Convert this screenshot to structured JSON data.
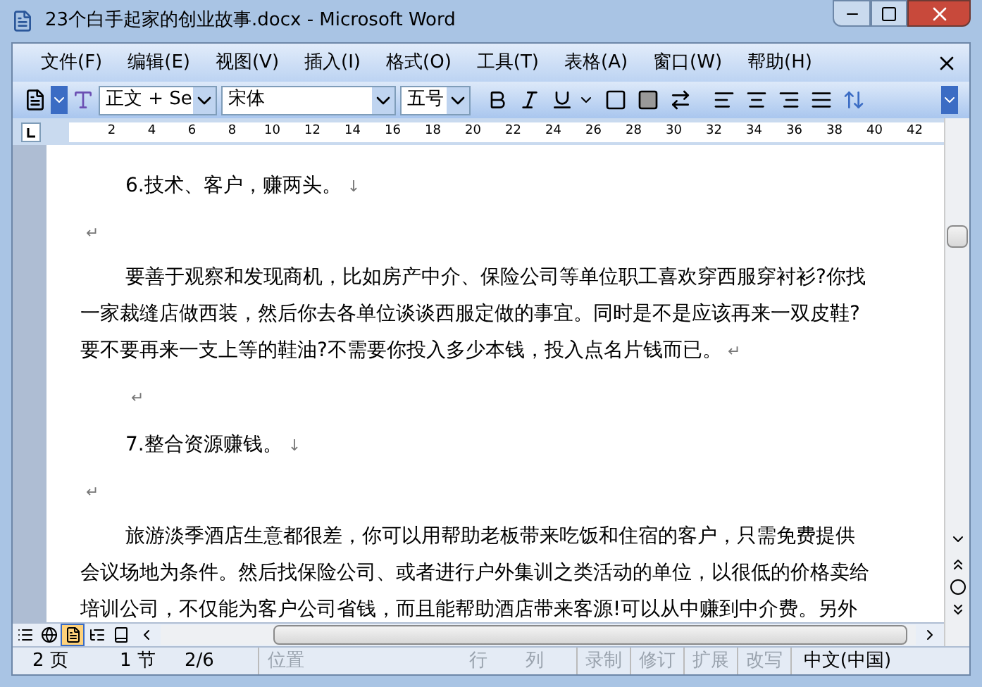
{
  "window": {
    "title": "23个白手起家的创业故事.docx - Microsoft Word"
  },
  "menu": [
    "文件(F)",
    "编辑(E)",
    "视图(V)",
    "插入(I)",
    "格式(O)",
    "工具(T)",
    "表格(A)",
    "窗口(W)",
    "帮助(H)"
  ],
  "toolbar": {
    "style": "正文 + Se",
    "font": "宋体",
    "size": "五号"
  },
  "ruler": [
    "2",
    "4",
    "6",
    "8",
    "10",
    "12",
    "14",
    "16",
    "18",
    "20",
    "22",
    "24",
    "26",
    "28",
    "30",
    "32",
    "34",
    "36",
    "38",
    "40",
    "42"
  ],
  "document": [
    {
      "kind": "heading",
      "lines": [
        "6.技术、客户，赚两头。"
      ],
      "mark": "↓"
    },
    {
      "kind": "empty",
      "mark": "↵"
    },
    {
      "kind": "paragraph",
      "lines": [
        "要善于观察和发现商机，比如房产中介、保险公司等单位职工喜欢穿西服穿衬衫?你找",
        "一家裁缝店做西装，然后你去各单位谈谈西服定做的事宜。同时是不是应该再来一双皮鞋?",
        "要不要再来一支上等的鞋油?不需要你投入多少本钱，投入点名片钱而已。"
      ],
      "mark": "↵"
    },
    {
      "kind": "centered",
      "mark": "↵"
    },
    {
      "kind": "heading",
      "lines": [
        "7.整合资源赚钱。"
      ],
      "mark": "↓"
    },
    {
      "kind": "empty",
      "mark": "↵"
    },
    {
      "kind": "paragraph",
      "lines": [
        "旅游淡季酒店生意都很差，你可以用帮助老板带来吃饭和住宿的客户，只需免费提供",
        "会议场地为条件。然后找保险公司、或者进行户外集训之类活动的单位，以很低的价格卖给",
        "培训公司，不仅能为客户公司省钱，而且能帮助酒店带来客源!可以从中赚到中介费。另外"
      ]
    }
  ],
  "view_buttons": [
    {
      "kind": "normal",
      "selected": false
    },
    {
      "kind": "web",
      "selected": false
    },
    {
      "kind": "print",
      "selected": true
    },
    {
      "kind": "outline",
      "selected": false
    },
    {
      "kind": "reading",
      "selected": false
    }
  ],
  "status_bar": [
    {
      "text": "2 页",
      "disabled": false
    },
    {
      "text": "1 节",
      "disabled": false
    },
    {
      "text": "2/6",
      "disabled": false
    },
    {
      "text": "位置",
      "disabled": true
    },
    {
      "text": "行",
      "disabled": true
    },
    {
      "text": "列",
      "disabled": true
    },
    {
      "text": "录制",
      "disabled": true
    },
    {
      "text": "修订",
      "disabled": true
    },
    {
      "text": "扩展",
      "disabled": true
    },
    {
      "text": "改写",
      "disabled": true
    },
    {
      "text": "中文(中国)",
      "disabled": false
    }
  ]
}
